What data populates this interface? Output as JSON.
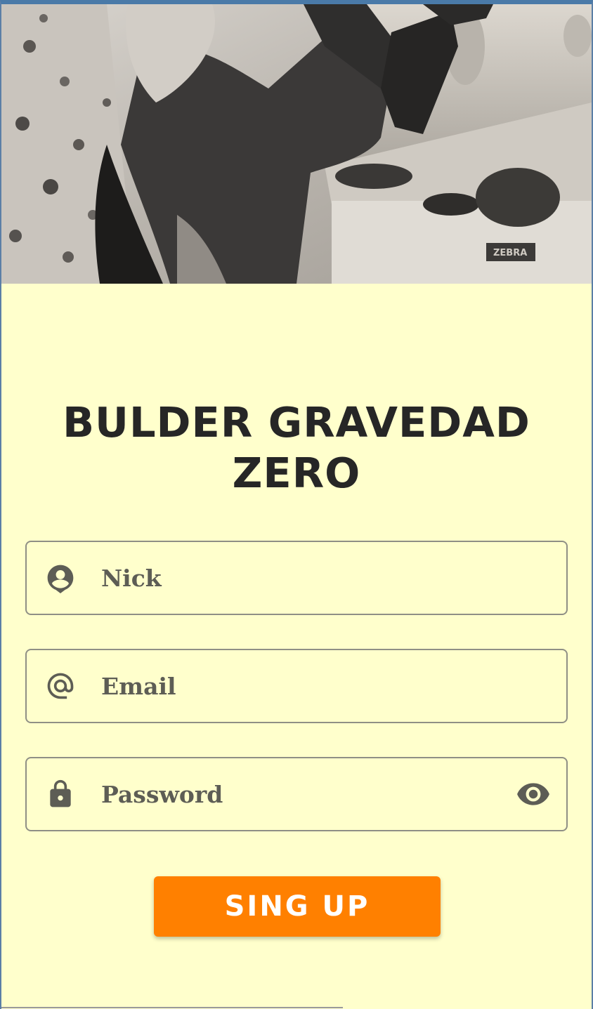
{
  "app": {
    "title": "BULDER GRAVEDAD ZERO"
  },
  "hero": {
    "image_icon": "climber-photo"
  },
  "form": {
    "nick": {
      "placeholder": "Nick",
      "icon": "account-circle-icon"
    },
    "email": {
      "placeholder": "Email",
      "icon": "at-sign-icon"
    },
    "password": {
      "placeholder": "Password",
      "icon": "lock-icon",
      "toggle_icon": "eye-icon"
    }
  },
  "actions": {
    "signup_label": "SING UP"
  },
  "colors": {
    "background": "#FFFFCC",
    "accent": "#FF8000",
    "title": "#262626",
    "field_text": "#5d5d55"
  }
}
